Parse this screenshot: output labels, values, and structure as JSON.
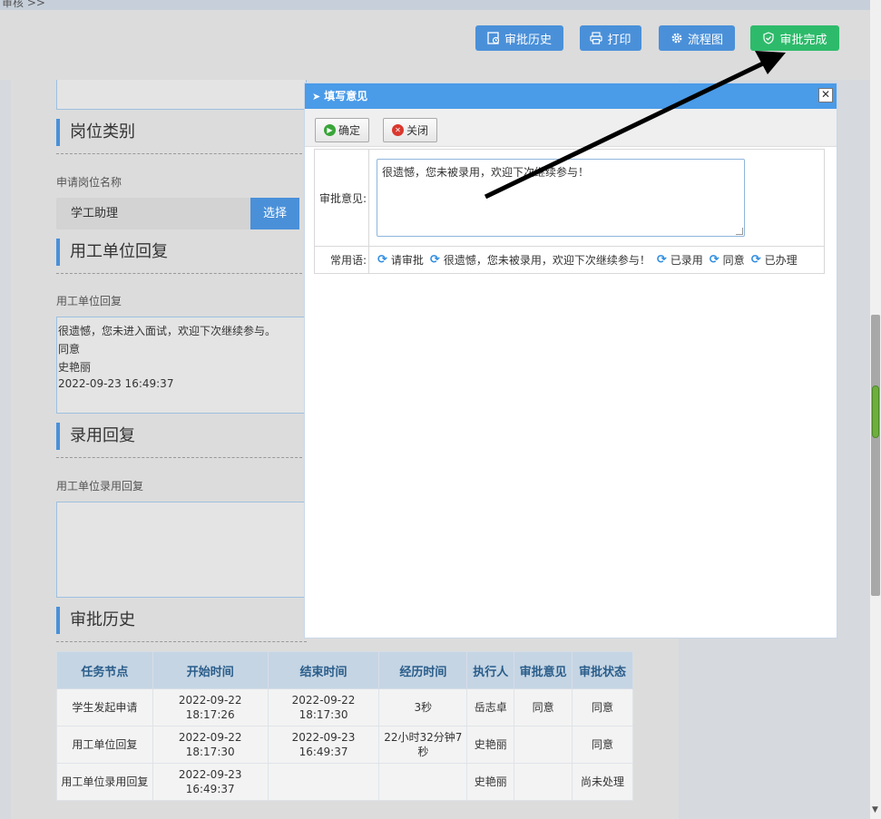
{
  "window": {
    "top_label": "审核 >>"
  },
  "toolbar": {
    "history_label": "审批历史",
    "print_label": "打印",
    "flow_label": "流程图",
    "complete_label": "审批完成"
  },
  "sections": {
    "post": {
      "title": "岗位类别",
      "field_label": "申请岗位名称",
      "field_value": "学工助理",
      "select_label": "选择"
    },
    "unit_reply": {
      "title": "用工单位回复",
      "field_label": "用工单位回复",
      "lines": [
        "很遗憾，您未进入面试，欢迎下次继续参与。",
        "同意",
        "史艳丽",
        "2022-09-23 16:49:37"
      ]
    },
    "hire_reply": {
      "title": "录用回复",
      "field_label": "用工单位录用回复"
    },
    "history": {
      "title": "审批历史",
      "columns": [
        "任务节点",
        "开始时间",
        "结束时间",
        "经历时间",
        "执行人",
        "审批意见",
        "审批状态"
      ],
      "rows": [
        [
          "学生发起申请",
          "2022-09-22 18:17:26",
          "2022-09-22 18:17:30",
          "3秒",
          "岳志卓",
          "同意",
          "同意"
        ],
        [
          "用工单位回复",
          "2022-09-22 18:17:30",
          "2022-09-23 16:49:37",
          "22小时32分钟7秒",
          "史艳丽",
          "",
          "同意"
        ],
        [
          "用工单位录用回复",
          "2022-09-23 16:49:37",
          "",
          "",
          "史艳丽",
          "",
          "尚未处理"
        ]
      ]
    }
  },
  "dialog": {
    "title": "填写意见",
    "confirm_label": "确定",
    "close_label": "关闭",
    "opinion_label": "审批意见:",
    "opinion_value": "很遗憾，您未被录用，欢迎下次继续参与！",
    "phrases_label": "常用语:",
    "phrases": [
      "请审批",
      "很遗憾，您未被录用，欢迎下次继续参与！",
      "已录用",
      "同意",
      "已办理"
    ]
  },
  "colors": {
    "accent": "#4a90d9",
    "success": "#2dbb6b",
    "dialog_header": "#4a9be8"
  }
}
